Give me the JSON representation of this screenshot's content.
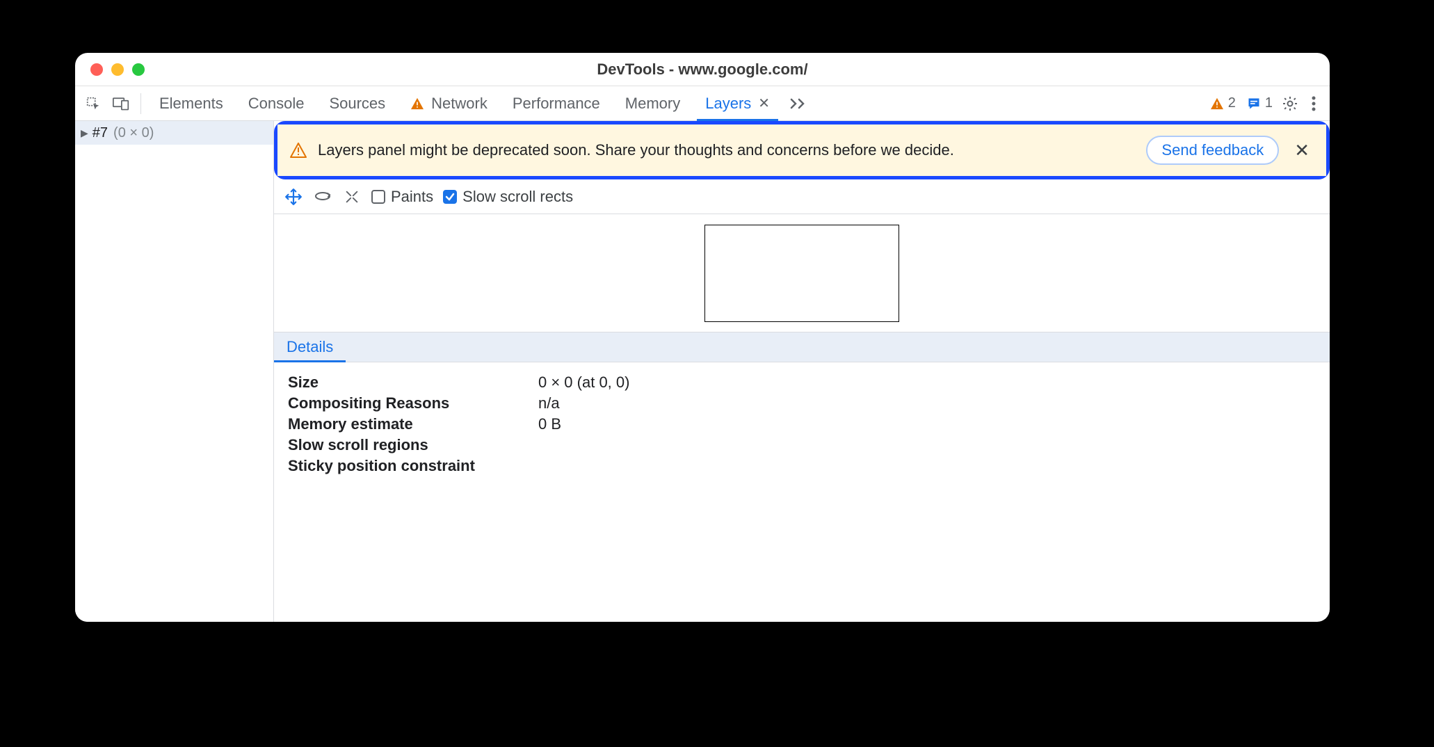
{
  "window": {
    "title": "DevTools - www.google.com/"
  },
  "tabs": {
    "elements": "Elements",
    "console": "Console",
    "sources": "Sources",
    "network": "Network",
    "performance": "Performance",
    "memory": "Memory",
    "layers": "Layers"
  },
  "counters": {
    "issues": "2",
    "messages": "1"
  },
  "sidebar": {
    "item0": {
      "label": "#7",
      "dim": "(0 × 0)"
    }
  },
  "banner": {
    "text": "Layers panel might be deprecated soon. Share your thoughts and concerns before we decide.",
    "button": "Send feedback"
  },
  "layertb": {
    "paints_label": "Paints",
    "slow_label": "Slow scroll rects"
  },
  "details": {
    "tab": "Details",
    "rows": {
      "size_k": "Size",
      "size_v": "0 × 0 (at 0, 0)",
      "comp_k": "Compositing Reasons",
      "comp_v": "n/a",
      "mem_k": "Memory estimate",
      "mem_v": "0 B",
      "slow_k": "Slow scroll regions",
      "slow_v": "",
      "sticky_k": "Sticky position constraint",
      "sticky_v": ""
    }
  }
}
